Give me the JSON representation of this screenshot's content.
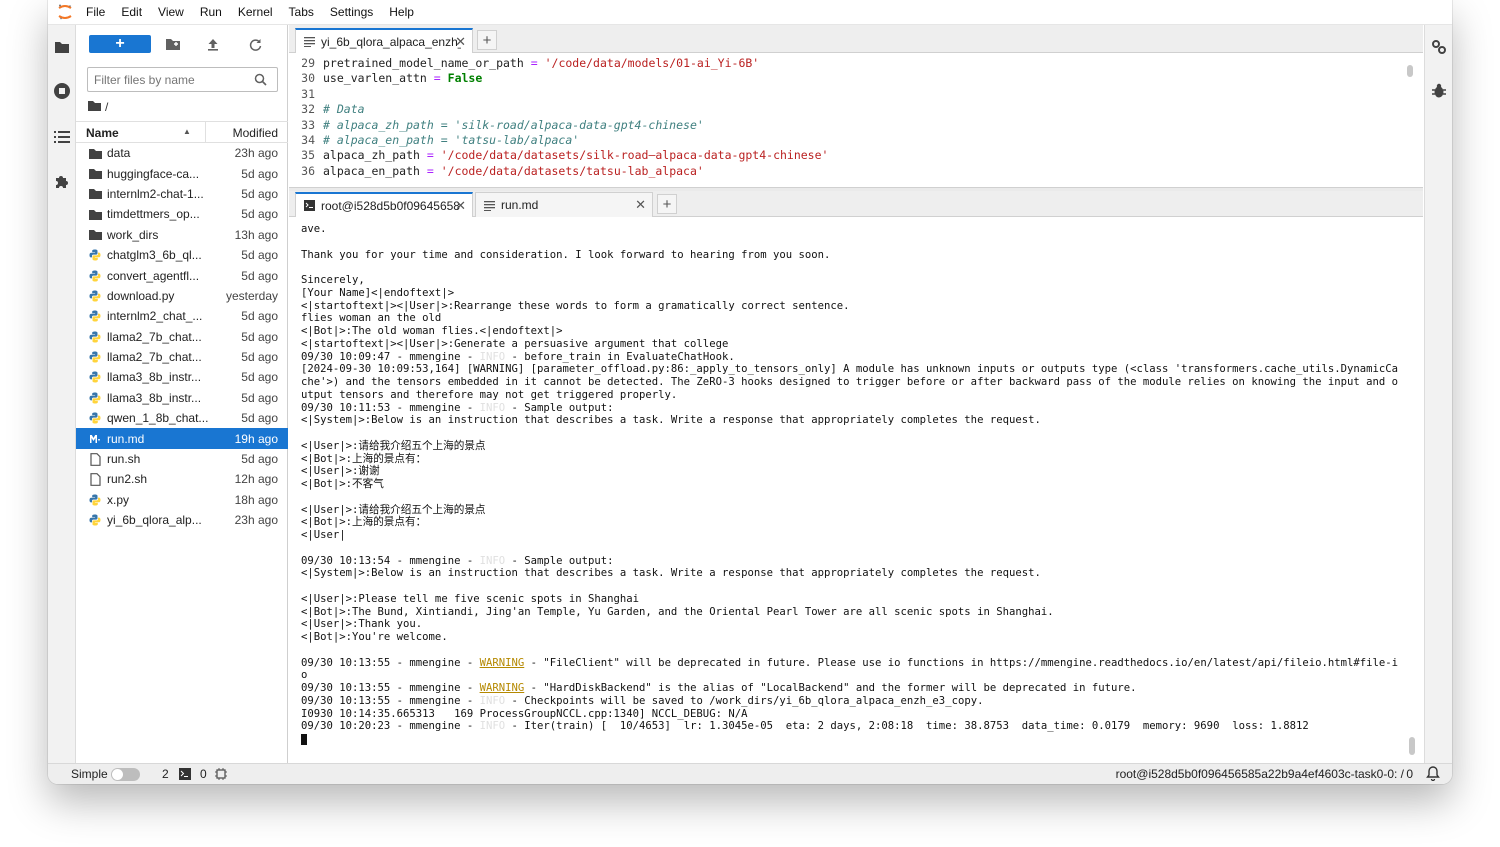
{
  "menubar": {
    "items": [
      "File",
      "Edit",
      "View",
      "Run",
      "Kernel",
      "Tabs",
      "Settings",
      "Help"
    ]
  },
  "filebrowser": {
    "new_label": "+",
    "filter_placeholder": "Filter files by name",
    "breadcrumb": "/",
    "col_name": "Name",
    "col_modified": "Modified",
    "files": [
      {
        "name": "data",
        "modified": "23h ago",
        "icon": "folder-icon"
      },
      {
        "name": "huggingface-ca...",
        "modified": "5d ago",
        "icon": "folder-icon"
      },
      {
        "name": "internlm2-chat-1...",
        "modified": "5d ago",
        "icon": "folder-icon"
      },
      {
        "name": "timdettmers_op...",
        "modified": "5d ago",
        "icon": "folder-icon"
      },
      {
        "name": "work_dirs",
        "modified": "13h ago",
        "icon": "folder-icon"
      },
      {
        "name": "chatglm3_6b_ql...",
        "modified": "5d ago",
        "icon": "python-icon"
      },
      {
        "name": "convert_agentfl...",
        "modified": "5d ago",
        "icon": "python-icon"
      },
      {
        "name": "download.py",
        "modified": "yesterday",
        "icon": "python-icon"
      },
      {
        "name": "internlm2_chat_...",
        "modified": "5d ago",
        "icon": "python-icon"
      },
      {
        "name": "llama2_7b_chat...",
        "modified": "5d ago",
        "icon": "python-icon"
      },
      {
        "name": "llama2_7b_chat...",
        "modified": "5d ago",
        "icon": "python-icon"
      },
      {
        "name": "llama3_8b_instr...",
        "modified": "5d ago",
        "icon": "python-icon"
      },
      {
        "name": "llama3_8b_instr...",
        "modified": "5d ago",
        "icon": "python-icon"
      },
      {
        "name": "qwen_1_8b_chat...",
        "modified": "5d ago",
        "icon": "python-icon"
      },
      {
        "name": "run.md",
        "modified": "19h ago",
        "icon": "markdown-icon",
        "selected": true
      },
      {
        "name": "run.sh",
        "modified": "5d ago",
        "icon": "file-icon"
      },
      {
        "name": "run2.sh",
        "modified": "12h ago",
        "icon": "file-icon"
      },
      {
        "name": "x.py",
        "modified": "18h ago",
        "icon": "python-icon"
      },
      {
        "name": "yi_6b_qlora_alp...",
        "modified": "23h ago",
        "icon": "python-icon"
      }
    ]
  },
  "editor": {
    "tab_label": "yi_6b_qlora_alpaca_enzh_ε",
    "lines": [
      {
        "num": "29",
        "parts": [
          [
            "",
            "pretrained_model_name_or_path "
          ],
          [
            "op",
            "="
          ],
          [
            "",
            " "
          ],
          [
            "str",
            "'/code/data/models/01-ai_Yi-6B'"
          ]
        ]
      },
      {
        "num": "30",
        "parts": [
          [
            "",
            "use_varlen_attn "
          ],
          [
            "op",
            "="
          ],
          [
            "",
            " "
          ],
          [
            "kw",
            "False"
          ]
        ]
      },
      {
        "num": "31",
        "parts": [
          [
            "",
            ""
          ]
        ]
      },
      {
        "num": "32",
        "parts": [
          [
            "cm",
            "# Data"
          ]
        ]
      },
      {
        "num": "33",
        "parts": [
          [
            "cm",
            "# alpaca_zh_path = 'silk-road/alpaca-data-gpt4-chinese'"
          ]
        ]
      },
      {
        "num": "34",
        "parts": [
          [
            "cm",
            "# alpaca_en_path = 'tatsu-lab/alpaca'"
          ]
        ]
      },
      {
        "num": "35",
        "parts": [
          [
            "",
            "alpaca_zh_path "
          ],
          [
            "op",
            "="
          ],
          [
            "",
            " "
          ],
          [
            "str",
            "'/code/data/datasets/silk-road—alpaca-data-gpt4-chinese'"
          ]
        ]
      },
      {
        "num": "36",
        "parts": [
          [
            "",
            "alpaca_en_path "
          ],
          [
            "op",
            "="
          ],
          [
            "",
            " "
          ],
          [
            "str",
            "'/code/data/datasets/tatsu-lab_alpaca'"
          ]
        ]
      }
    ]
  },
  "terminal": {
    "tab_label": "root@i528d5b0f09645658",
    "second_tab_label": "run.md",
    "lines": [
      [
        [
          "",
          "ave."
        ]
      ],
      [
        [
          "",
          ""
        ]
      ],
      [
        [
          "",
          "Thank you for your time and consideration. I look forward to hearing from you soon."
        ]
      ],
      [
        [
          "",
          ""
        ]
      ],
      [
        [
          "",
          "Sincerely,"
        ]
      ],
      [
        [
          "",
          "[Your Name]<|endoftext|>"
        ]
      ],
      [
        [
          "",
          "<|startoftext|><|User|>:Rearrange these words to form a gramatically correct sentence."
        ]
      ],
      [
        [
          "",
          "flies woman an the old"
        ]
      ],
      [
        [
          "",
          "<|Bot|>:The old woman flies.<|endoftext|>"
        ]
      ],
      [
        [
          "",
          "<|startoftext|><|User|>:Generate a persuasive argument that college"
        ]
      ],
      [
        [
          "",
          "09/30 10:09:47 - mmengine - "
        ],
        [
          "info",
          "INFO"
        ],
        [
          "",
          " - before_train in EvaluateChatHook."
        ]
      ],
      [
        [
          "",
          "[2024-09-30 10:09:53,164] [WARNING] [parameter_offload.py:86:_apply_to_tensors_only] A module has unknown inputs or outputs type (<class 'transformers.cache_utils.DynamicCa"
        ]
      ],
      [
        [
          "",
          "che'>) and the tensors embedded in it cannot be detected. The ZeRO-3 hooks designed to trigger before or after backward pass of the module relies on knowing the input and o"
        ]
      ],
      [
        [
          "",
          "utput tensors and therefore may not get triggered properly."
        ]
      ],
      [
        [
          "",
          "09/30 10:11:53 - mmengine - "
        ],
        [
          "info",
          "INFO"
        ],
        [
          "",
          " - Sample output:"
        ]
      ],
      [
        [
          "",
          "<|System|>:Below is an instruction that describes a task. Write a response that appropriately completes the request."
        ]
      ],
      [
        [
          "",
          ""
        ]
      ],
      [
        [
          "",
          "<|User|>:请给我介绍五个上海的景点"
        ]
      ],
      [
        [
          "",
          "<|Bot|>:上海的景点有："
        ]
      ],
      [
        [
          "",
          "<|User|>:谢谢"
        ]
      ],
      [
        [
          "",
          "<|Bot|>:不客气"
        ]
      ],
      [
        [
          "",
          ""
        ]
      ],
      [
        [
          "",
          "<|User|>:请给我介绍五个上海的景点"
        ]
      ],
      [
        [
          "",
          "<|Bot|>:上海的景点有："
        ]
      ],
      [
        [
          "",
          "<|User|"
        ]
      ],
      [
        [
          "",
          ""
        ]
      ],
      [
        [
          "",
          "09/30 10:13:54 - mmengine - "
        ],
        [
          "info",
          "INFO"
        ],
        [
          "",
          " - Sample output:"
        ]
      ],
      [
        [
          "",
          "<|System|>:Below is an instruction that describes a task. Write a response that appropriately completes the request."
        ]
      ],
      [
        [
          "",
          ""
        ]
      ],
      [
        [
          "",
          "<|User|>:Please tell me five scenic spots in Shanghai"
        ]
      ],
      [
        [
          "",
          "<|Bot|>:The Bund, Xintiandi, Jing'an Temple, Yu Garden, and the Oriental Pearl Tower are all scenic spots in Shanghai."
        ]
      ],
      [
        [
          "",
          "<|User|>:Thank you."
        ]
      ],
      [
        [
          "",
          "<|Bot|>:You're welcome."
        ]
      ],
      [
        [
          "",
          ""
        ]
      ],
      [
        [
          "",
          "09/30 10:13:55 - mmengine - "
        ],
        [
          "warn",
          "WARNING"
        ],
        [
          "",
          " - \"FileClient\" will be deprecated in future. Please use io functions in https://mmengine.readthedocs.io/en/latest/api/fileio.html#file-i"
        ]
      ],
      [
        [
          "",
          "o"
        ]
      ],
      [
        [
          "",
          "09/30 10:13:55 - mmengine - "
        ],
        [
          "warn",
          "WARNING"
        ],
        [
          "",
          " - \"HardDiskBackend\" is the alias of \"LocalBackend\" and the former will be deprecated in future."
        ]
      ],
      [
        [
          "",
          "09/30 10:13:55 - mmengine - "
        ],
        [
          "info",
          "INFO"
        ],
        [
          "",
          " - Checkpoints will be saved to /work_dirs/yi_6b_qlora_alpaca_enzh_e3_copy."
        ]
      ],
      [
        [
          "",
          "I0930 10:14:35.665313   169 ProcessGroupNCCL.cpp:1340] NCCL_DEBUG: N/A"
        ]
      ],
      [
        [
          "",
          "09/30 10:20:23 - mmengine - "
        ],
        [
          "info",
          "INFO"
        ],
        [
          "",
          " - Iter(train) [  10/4653]  lr: 1.3045e-05  eta: 2 days, 2:08:18  time: 38.8753  data_time: 0.0179  memory: 9690  loss: 1.8812"
        ]
      ]
    ]
  },
  "statusbar": {
    "simple_label": "Simple",
    "terminals_count": "2",
    "kernels_count": "0",
    "session": "root@i528d5b0f096456585a22b9a4ef4603c-task0-0: /",
    "notifications": "0"
  }
}
